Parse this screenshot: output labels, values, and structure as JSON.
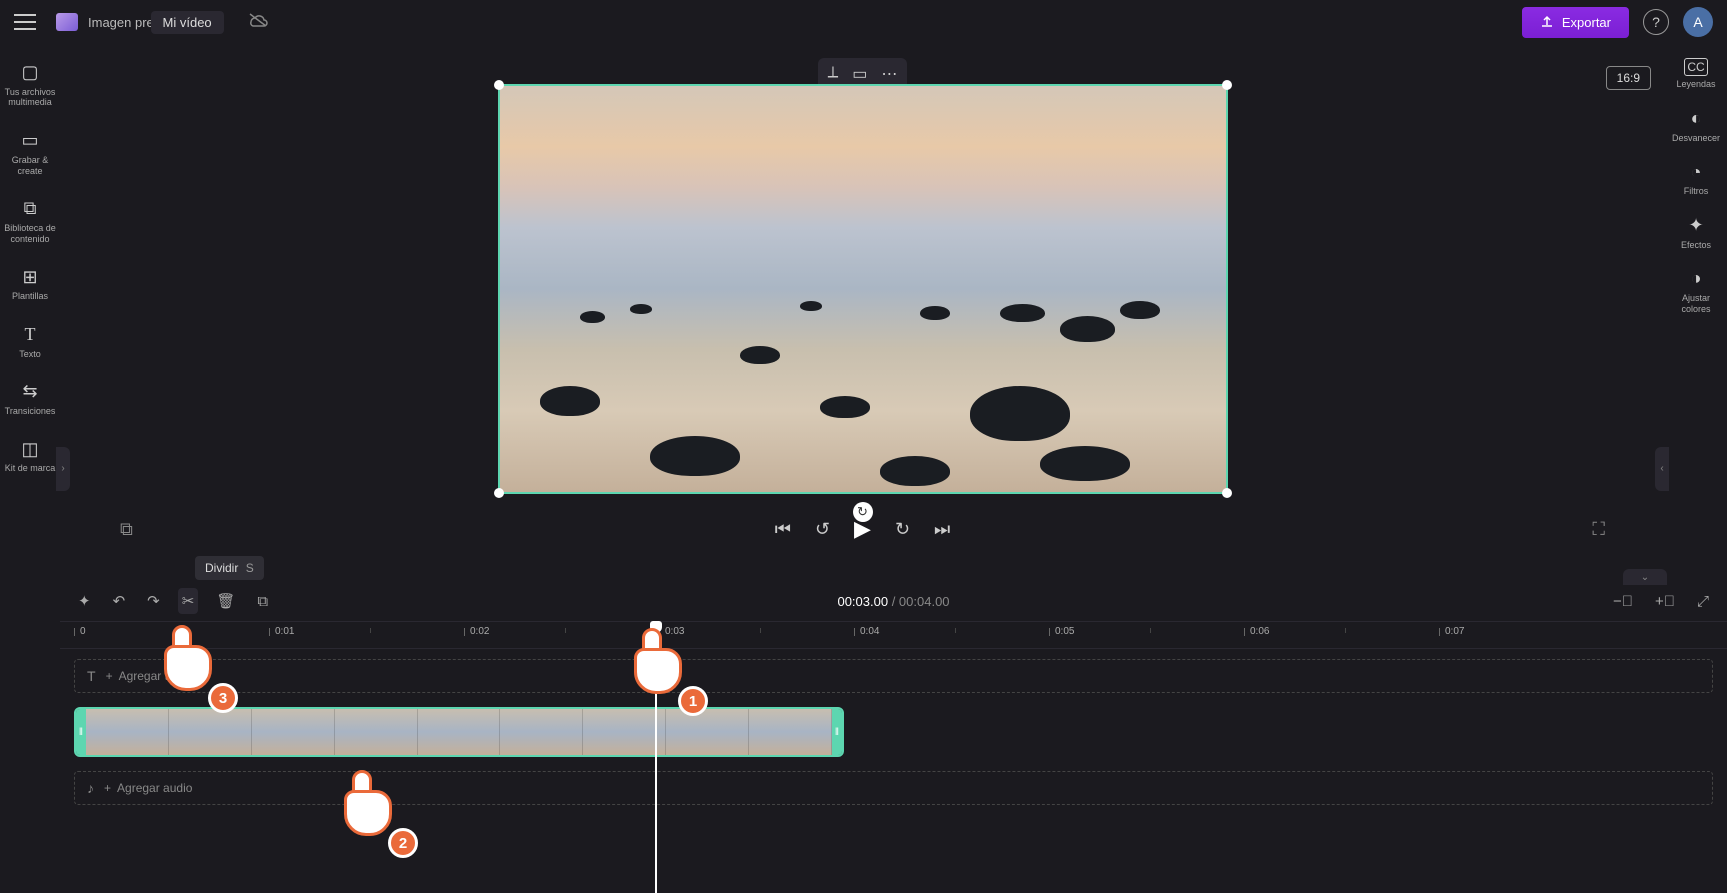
{
  "header": {
    "breadcrumb": "Imagen prediseñada",
    "project_pill": "Mi vídeo",
    "export_label": "Exportar",
    "avatar_letter": "A"
  },
  "left_sidebar": {
    "items": [
      {
        "icon": "📁",
        "label": "Tus archivos multimedia",
        "name": "your-media"
      },
      {
        "icon": "📹",
        "label": "Grabar &amp; create",
        "name": "record-create"
      },
      {
        "icon": "🎞",
        "label": "Biblioteca de contenido",
        "name": "content-library"
      },
      {
        "icon": "⊞",
        "label": "Plantillas",
        "name": "templates"
      },
      {
        "icon": "T",
        "label": "Texto",
        "name": "text"
      },
      {
        "icon": "⇆",
        "label": "Transiciones",
        "name": "transitions"
      },
      {
        "icon": "◫",
        "label": "Kit de marca",
        "name": "brand-kit"
      }
    ]
  },
  "right_sidebar": {
    "items": [
      {
        "icon": "CC",
        "label": "Leyendas",
        "name": "captions"
      },
      {
        "icon": "◐",
        "label": "Desvanecer",
        "name": "fade"
      },
      {
        "icon": "◔",
        "label": "Filtros",
        "name": "filters"
      },
      {
        "icon": "✨",
        "label": "Efectos",
        "name": "effects"
      },
      {
        "icon": "◑",
        "label": "Ajustar colores",
        "name": "adjust-colors"
      }
    ]
  },
  "canvas": {
    "aspect_label": "16:9"
  },
  "tooltip": {
    "label": "Dividir",
    "key": "S"
  },
  "timeline": {
    "current_time": "00:03.00",
    "duration": "00:04.00",
    "ruler": [
      "0",
      "0:01",
      "0:02",
      "0:03",
      "0:04",
      "0:05",
      "0:06",
      "0:07"
    ],
    "text_track_label": "Agregar texto",
    "audio_track_label": "Agregar audio"
  },
  "callouts": {
    "c1": "1",
    "c2": "2",
    "c3": "3"
  }
}
